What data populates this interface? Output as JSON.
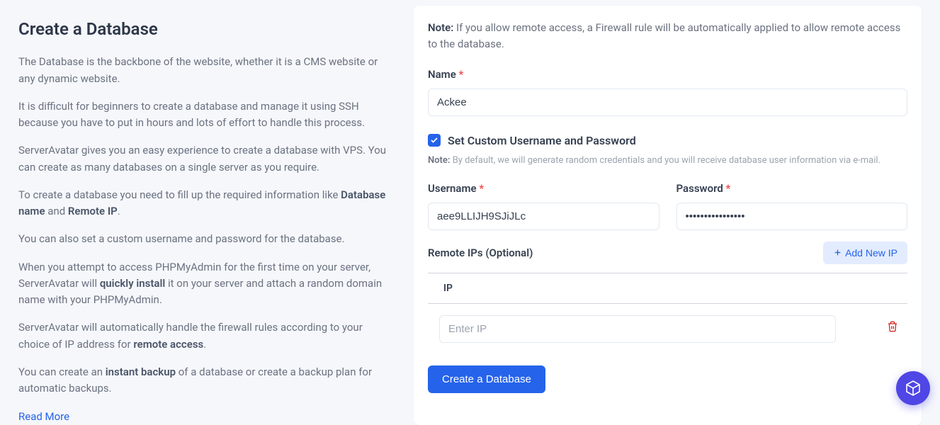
{
  "left": {
    "title": "Create a Database",
    "p1": "The Database is the backbone of the website, whether it is a CMS website or any dynamic website.",
    "p2": "It is difficult for beginners to create a database and manage it using SSH because you have to put in hours and lots of effort to handle this process.",
    "p3": "ServerAvatar gives you an easy experience to create a database with VPS. You can create as many databases on a single server as you require.",
    "p4_a": "To create a database you need to fill up the required information like ",
    "p4_b": "Database name",
    "p4_c": " and ",
    "p4_d": "Remote IP",
    "p4_e": ".",
    "p5": "You can also set a custom username and password for the database.",
    "p6_a": "When you attempt to access PHPMyAdmin for the first time on your server, ServerAvatar will ",
    "p6_b": "quickly install",
    "p6_c": " it on your server and attach a random domain name with your PHPMyAdmin.",
    "p7_a": "ServerAvatar will automatically handle the firewall rules according to your choice of IP address for ",
    "p7_b": "remote access",
    "p7_c": ".",
    "p8_a": "You can create an ",
    "p8_b": "instant backup",
    "p8_c": " of a database or create a backup plan for automatic backups.",
    "read_more": "Read More"
  },
  "form": {
    "note_label": "Note:",
    "note_text": " If you allow remote access, a Firewall rule will be automatically applied to allow remote access to the database.",
    "name_label": "Name",
    "name_value": "Ackee",
    "custom_label": "Set Custom Username and Password",
    "custom_checked": true,
    "sub_note_label": "Note:",
    "sub_note_text": " By default, we will generate random credentials and you will receive database user information via e-mail.",
    "username_label": "Username",
    "username_value": "aee9LLIJH9SJiJLc",
    "password_label": "Password",
    "password_value": "••••••••••••••••",
    "remote_label": "Remote IPs (Optional)",
    "add_ip_label": "Add New IP",
    "ip_header": "IP",
    "ip_placeholder": "Enter IP",
    "submit_label": "Create a Database"
  }
}
